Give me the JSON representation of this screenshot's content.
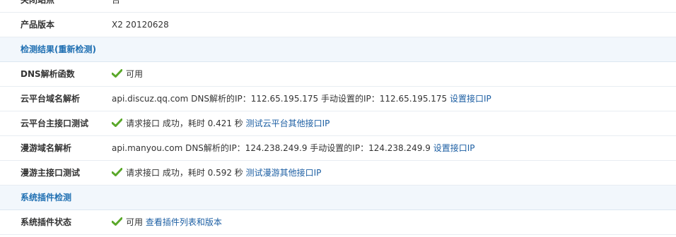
{
  "rows": {
    "close_site": {
      "label": "关闭站点",
      "value": "否"
    },
    "version": {
      "label": "产品版本",
      "value": "X2 20120628"
    },
    "check_header": {
      "title": "检测结果",
      "recheck": "(重新检测)"
    },
    "dns_func": {
      "label": "DNS解析函数",
      "status": "可用"
    },
    "cloud_domain": {
      "label": "云平台域名解析",
      "text": "api.discuz.qq.com DNS解析的IP：112.65.195.175 手动设置的IP：112.65.195.175",
      "link": "设置接口IP"
    },
    "cloud_api": {
      "label": "云平台主接口测试",
      "status": "请求接口 成功，耗时 0.421 秒",
      "link": "测试云平台其他接口IP"
    },
    "manyou_domain": {
      "label": "漫游域名解析",
      "text": "api.manyou.com DNS解析的IP：124.238.249.9 手动设置的IP：124.238.249.9",
      "link": "设置接口IP"
    },
    "manyou_api": {
      "label": "漫游主接口测试",
      "status": "请求接口 成功，耗时 0.592 秒",
      "link": "测试漫游其他接口IP"
    },
    "plugin_header": {
      "title": "系统插件检测"
    },
    "plugin_status": {
      "label": "系统插件状态",
      "status": "可用",
      "link": "查看插件列表和版本"
    }
  },
  "icons": {
    "check": "check-icon"
  },
  "colors": {
    "check_green": "#5aa82a",
    "link_blue": "#1d5fa3",
    "header_blue": "#1f6fb2",
    "header_bg": "#f2f7fc"
  }
}
